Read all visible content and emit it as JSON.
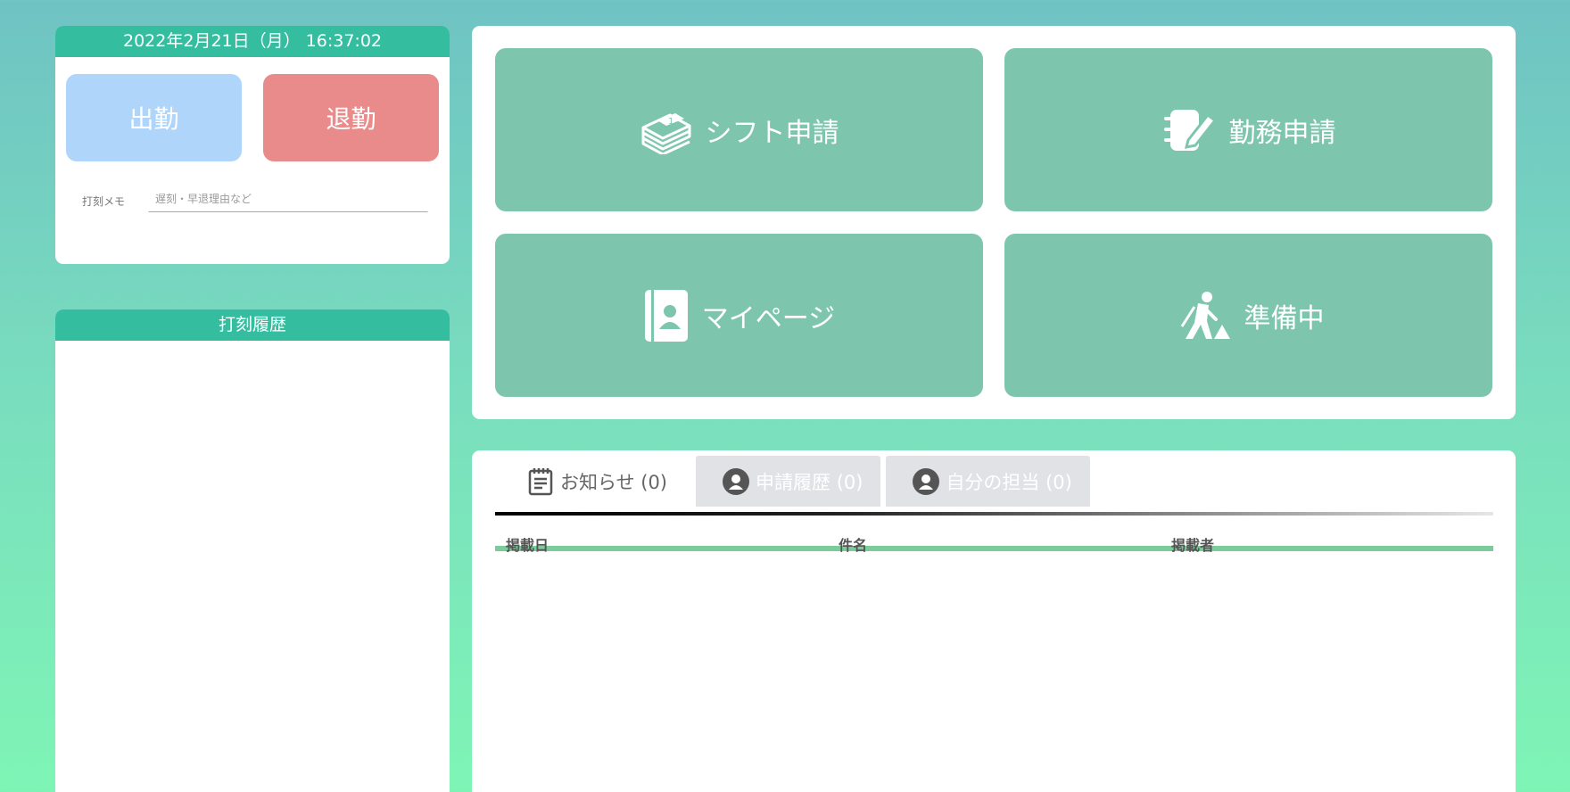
{
  "clock": {
    "datetime": "2022年2月21日（月） 16:37:02",
    "clock_in_label": "出勤",
    "clock_out_label": "退勤",
    "memo_label": "打刻メモ",
    "memo_placeholder": "遅刻・早退理由など",
    "memo_value": ""
  },
  "history": {
    "title": "打刻履歴"
  },
  "menu": {
    "tiles": [
      {
        "label": "シフト申請",
        "icon": "calendar-stack-icon"
      },
      {
        "label": "勤務申請",
        "icon": "notebook-pen-icon"
      },
      {
        "label": "マイページ",
        "icon": "contact-book-icon"
      },
      {
        "label": "準備中",
        "icon": "construction-worker-icon"
      }
    ]
  },
  "notices": {
    "tabs": [
      {
        "label": "お知らせ (0)",
        "active": true,
        "icon": "notepad-icon"
      },
      {
        "label": "申請履歴 (0)",
        "active": false,
        "icon": "user-circle-icon"
      },
      {
        "label": "自分の担当 (0)",
        "active": false,
        "icon": "user-circle-icon"
      }
    ],
    "columns": [
      "掲載日",
      "件名",
      "掲載者"
    ]
  },
  "colors": {
    "header_green": "#35bda0",
    "tile_green": "#7dc6ad",
    "clock_in_blue": "#afd5fa",
    "clock_out_red": "#ea8b8b",
    "table_underline": "#7ccc9b"
  }
}
